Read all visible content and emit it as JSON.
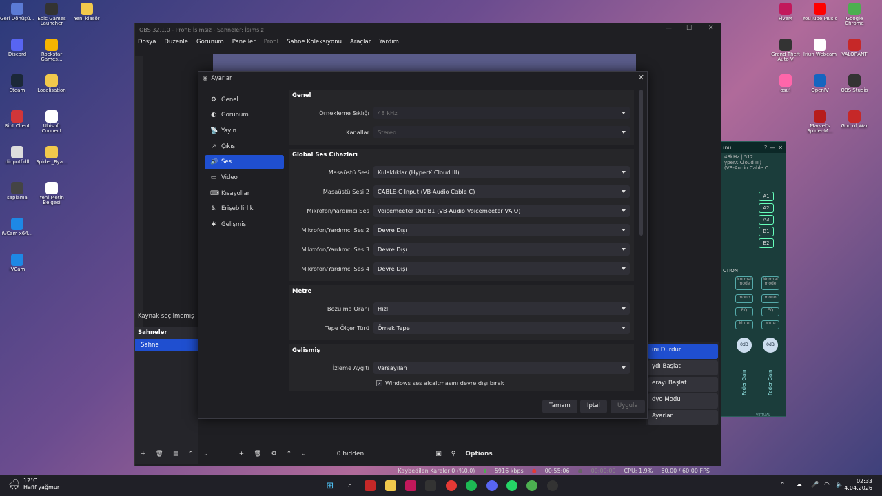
{
  "desktop_left": [
    {
      "label": "Geri Dönüşü...",
      "color": "#5b7bd5"
    },
    {
      "label": "Discord",
      "color": "#5865f2"
    },
    {
      "label": "Steam",
      "color": "#1b2838"
    },
    {
      "label": "Riot Client",
      "color": "#d13639"
    },
    {
      "label": "dinputf.dll",
      "color": "#ddd"
    },
    {
      "label": "saplama",
      "color": "#444"
    },
    {
      "label": "iVCam x64...",
      "color": "#1e88e5"
    },
    {
      "label": "iVCam",
      "color": "#1e88e5"
    }
  ],
  "desktop_left2": [
    {
      "label": "Epic Games Launcher",
      "color": "#333"
    },
    {
      "label": "Rockstar Games...",
      "color": "#f6b400"
    },
    {
      "label": "Localisation",
      "color": "#f2c94c"
    },
    {
      "label": "Ubisoft Connect",
      "color": "#fff"
    },
    {
      "label": "Spider_Rya...",
      "color": "#f2c94c"
    },
    {
      "label": "Yeni Metin Belgesi",
      "color": "#fff"
    }
  ],
  "desktop_left3": [
    {
      "label": "Yeni klasör",
      "color": "#f2c94c"
    }
  ],
  "desktop_right": [
    {
      "label": "FiveM",
      "color": "#c2185b"
    },
    {
      "label": "YouTube Music",
      "color": "#ff0000"
    },
    {
      "label": "Google Chrome",
      "color": "#4caf50"
    },
    {
      "label": "Grand Theft Auto V",
      "color": "#333"
    },
    {
      "label": "Iriun Webcam",
      "color": "#fff"
    },
    {
      "label": "VALORANT",
      "color": "#c62828"
    },
    {
      "label": "osu!",
      "color": "#ff66aa"
    },
    {
      "label": "OpenIV",
      "color": "#1565c0"
    },
    {
      "label": "OBS Studio",
      "color": "#333"
    },
    {
      "label": "Marvel's Spider-M...",
      "color": "#b71c1c"
    },
    {
      "label": "God of War",
      "color": "#c62828"
    }
  ],
  "obs": {
    "title": "OBS 32.1.0 - Profil: İsimsiz - Sahneler: İsimsiz",
    "menu": [
      "Dosya",
      "Düzenle",
      "Görünüm",
      "Paneller",
      "Profil",
      "Sahne Koleksiyonu",
      "Araçlar",
      "Yardım"
    ],
    "source_empty": "Kaynak seçilmemiş",
    "scenes_header": "Sahneler",
    "scene_selected": "Sahne",
    "hidden": "0 hidden",
    "options": "Options",
    "status": {
      "dropped": "Kaybedilen Kareler 0 (%0.0)",
      "bitrate": "5916 kbps",
      "rec_time": "00:55:06",
      "stream_time": "00:00:00",
      "cpu": "CPU: 1.9%",
      "fps": "60.00 / 60.00 FPS"
    },
    "controls": [
      "ını Durdur",
      "ydı Başlat",
      "erayı Başlat",
      "dyo Modu",
      "Ayarlar"
    ],
    "mixer_title": "ınu",
    "mixer_info": "48kHz | 512",
    "mixer_device1": "yperX Cloud III)",
    "mixer_device2": "(VB-Audio Cable C",
    "mixer_buses": [
      "A1",
      "A2",
      "A3",
      "B1",
      "B2"
    ],
    "mixer_section": "CTION",
    "mixer_normal": "Normal mode",
    "mixer_mono": "mono",
    "mixer_eq": "EQ",
    "mixer_mute": "Mute",
    "mixer_db": "0dB",
    "mixer_fader": "Fader Gain",
    "mixer_virtual": "VIRTUAL"
  },
  "dialog": {
    "title": "Ayarlar",
    "nav": [
      {
        "label": "Genel",
        "icon": "⚙"
      },
      {
        "label": "Görünüm",
        "icon": "◐"
      },
      {
        "label": "Yayın",
        "icon": "📡"
      },
      {
        "label": "Çıkış",
        "icon": "↗"
      },
      {
        "label": "Ses",
        "icon": "🔊"
      },
      {
        "label": "Video",
        "icon": "▭"
      },
      {
        "label": "Kısayollar",
        "icon": "⌨"
      },
      {
        "label": "Erişebilirlik",
        "icon": "♿"
      },
      {
        "label": "Gelişmiş",
        "icon": "✱"
      }
    ],
    "sections": {
      "genel": {
        "title": "Genel",
        "sample_rate_label": "Örnekleme Sıklığı",
        "sample_rate": "48 kHz",
        "channels_label": "Kanallar",
        "channels": "Stereo"
      },
      "devices": {
        "title": "Global Ses Cihazları",
        "rows": [
          {
            "label": "Masaüstü Sesi",
            "value": "Kulaklıklar (HyperX Cloud III)"
          },
          {
            "label": "Masaüstü Sesi 2",
            "value": "CABLE-C Input (VB-Audio Cable C)"
          },
          {
            "label": "Mikrofon/Yardımcı Ses",
            "value": "Voicemeeter Out B1 (VB-Audio Voicemeeter VAIO)"
          },
          {
            "label": "Mikrofon/Yardımcı Ses 2",
            "value": "Devre Dışı"
          },
          {
            "label": "Mikrofon/Yardımcı Ses 3",
            "value": "Devre Dışı"
          },
          {
            "label": "Mikrofon/Yardımcı Ses 4",
            "value": "Devre Dışı"
          }
        ]
      },
      "metre": {
        "title": "Metre",
        "decay_label": "Bozulma Oranı",
        "decay": "Hızlı",
        "peak_label": "Tepe Ölçer Türü",
        "peak": "Örnek Tepe"
      },
      "gelismis": {
        "title": "Gelişmiş",
        "monitor_label": "İzleme Aygıtı",
        "monitor": "Varsayılan",
        "ducking": "Windows ses alçaltmasını devre dışı bırak"
      }
    },
    "buttons": {
      "ok": "Tamam",
      "cancel": "İptal",
      "apply": "Uygula"
    }
  },
  "taskbar": {
    "temp": "12°C",
    "weather": "Hafif yağmur",
    "time": "02:33",
    "date": "4.04.2026"
  }
}
